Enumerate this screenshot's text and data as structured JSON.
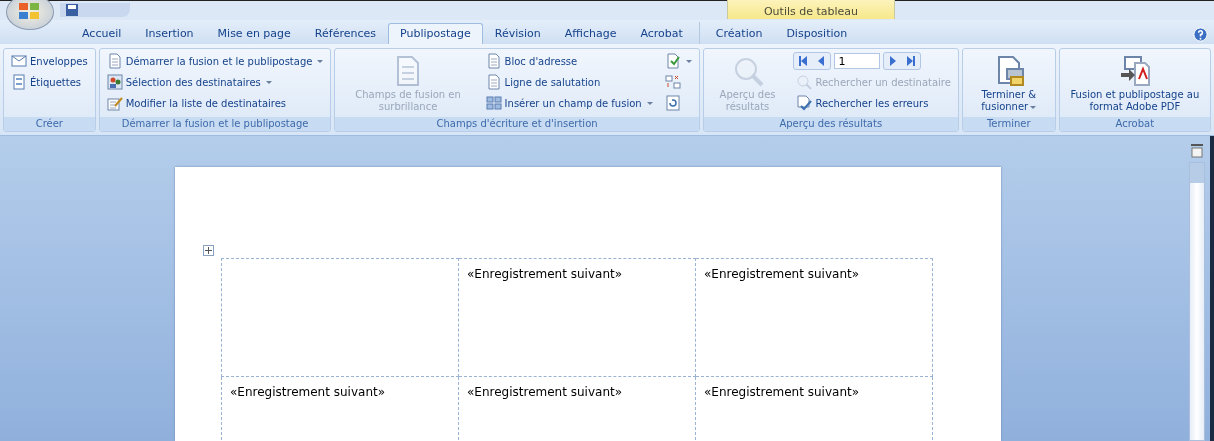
{
  "contextual_tab_group": {
    "label": "Outils de tableau"
  },
  "tabs": [
    {
      "label": "Accueil",
      "selected": false
    },
    {
      "label": "Insertion",
      "selected": false
    },
    {
      "label": "Mise en page",
      "selected": false
    },
    {
      "label": "Références",
      "selected": false
    },
    {
      "label": "Publipostage",
      "selected": true
    },
    {
      "label": "Révision",
      "selected": false
    },
    {
      "label": "Affichage",
      "selected": false
    },
    {
      "label": "Acrobat",
      "selected": false
    }
  ],
  "contextual_tabs": [
    {
      "label": "Création",
      "selected": false
    },
    {
      "label": "Disposition",
      "selected": false
    }
  ],
  "ribbon_groups": [
    {
      "title": "Créer",
      "columns": [
        [
          {
            "kind": "small",
            "label": "Enveloppes",
            "disabled": false,
            "dropdown": false
          },
          {
            "kind": "small",
            "label": "Étiquettes",
            "disabled": false,
            "dropdown": false
          }
        ]
      ]
    },
    {
      "title": "Démarrer la fusion et le publipostage",
      "columns": [
        [
          {
            "kind": "small",
            "label": "Démarrer la fusion et le publipostage",
            "disabled": false,
            "dropdown": true
          },
          {
            "kind": "small",
            "label": "Sélection des destinataires",
            "disabled": false,
            "dropdown": true
          },
          {
            "kind": "small",
            "label": "Modifier la liste de destinataires",
            "disabled": false,
            "dropdown": false
          }
        ]
      ]
    },
    {
      "title": "Champs d'écriture et d'insertion",
      "columns": [
        [
          {
            "kind": "large",
            "label": "Champs de fusion en surbrillance",
            "disabled": true,
            "dropdown": false
          }
        ],
        [
          {
            "kind": "small",
            "label": "Bloc d'adresse",
            "disabled": false,
            "dropdown": false
          },
          {
            "kind": "small",
            "label": "Ligne de salutation",
            "disabled": false,
            "dropdown": false
          },
          {
            "kind": "small",
            "label": "Insérer un champ de fusion",
            "disabled": false,
            "dropdown": true
          }
        ],
        [
          {
            "kind": "icon",
            "disabled": false,
            "dropdown": true
          },
          {
            "kind": "icon",
            "disabled": false,
            "dropdown": false
          },
          {
            "kind": "icon",
            "disabled": false,
            "dropdown": false
          }
        ]
      ]
    },
    {
      "title": "Aperçu des résultats",
      "columns": [
        [
          {
            "kind": "large",
            "label": "Aperçu des résultats",
            "disabled": true,
            "dropdown": false
          }
        ],
        [
          {
            "kind": "nav",
            "value": "1"
          },
          {
            "kind": "small",
            "label": "Rechercher un destinataire",
            "disabled": true,
            "dropdown": false
          },
          {
            "kind": "small",
            "label": "Rechercher les erreurs",
            "disabled": false,
            "dropdown": false
          }
        ]
      ]
    },
    {
      "title": "Terminer",
      "columns": [
        [
          {
            "kind": "large",
            "label": "Terminer & fusionner",
            "disabled": false,
            "dropdown": true
          }
        ]
      ]
    },
    {
      "title": "Acrobat",
      "columns": [
        [
          {
            "kind": "large",
            "label": "Fusion et publipostage au format Adobe PDF",
            "disabled": false,
            "dropdown": false
          }
        ]
      ]
    }
  ],
  "document": {
    "table": {
      "rows": [
        [
          "",
          "«Enregistrement suivant»",
          "«Enregistrement suivant»"
        ],
        [
          "«Enregistrement suivant»",
          "«Enregistrement suivant»",
          "«Enregistrement suivant»"
        ]
      ]
    }
  }
}
